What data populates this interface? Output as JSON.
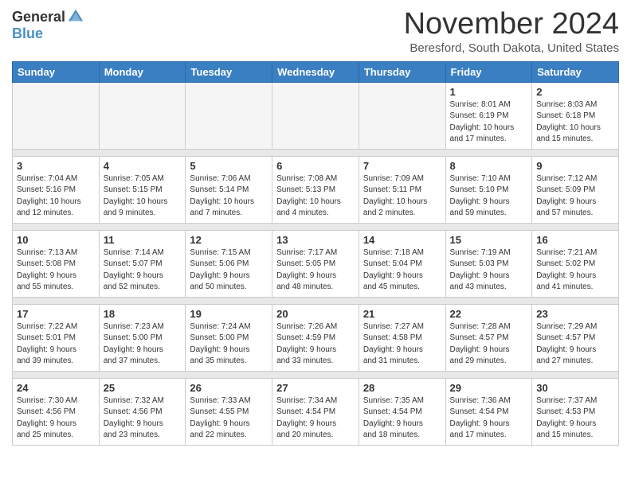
{
  "header": {
    "logo_general": "General",
    "logo_blue": "Blue",
    "month_title": "November 2024",
    "location": "Beresford, South Dakota, United States"
  },
  "days_of_week": [
    "Sunday",
    "Monday",
    "Tuesday",
    "Wednesday",
    "Thursday",
    "Friday",
    "Saturday"
  ],
  "weeks": [
    [
      {
        "day": "",
        "empty": true
      },
      {
        "day": "",
        "empty": true
      },
      {
        "day": "",
        "empty": true
      },
      {
        "day": "",
        "empty": true
      },
      {
        "day": "",
        "empty": true
      },
      {
        "day": "1",
        "info": "Sunrise: 8:01 AM\nSunset: 6:19 PM\nDaylight: 10 hours\nand 17 minutes."
      },
      {
        "day": "2",
        "info": "Sunrise: 8:03 AM\nSunset: 6:18 PM\nDaylight: 10 hours\nand 15 minutes."
      }
    ],
    [
      {
        "day": "3",
        "info": "Sunrise: 7:04 AM\nSunset: 5:16 PM\nDaylight: 10 hours\nand 12 minutes."
      },
      {
        "day": "4",
        "info": "Sunrise: 7:05 AM\nSunset: 5:15 PM\nDaylight: 10 hours\nand 9 minutes."
      },
      {
        "day": "5",
        "info": "Sunrise: 7:06 AM\nSunset: 5:14 PM\nDaylight: 10 hours\nand 7 minutes."
      },
      {
        "day": "6",
        "info": "Sunrise: 7:08 AM\nSunset: 5:13 PM\nDaylight: 10 hours\nand 4 minutes."
      },
      {
        "day": "7",
        "info": "Sunrise: 7:09 AM\nSunset: 5:11 PM\nDaylight: 10 hours\nand 2 minutes."
      },
      {
        "day": "8",
        "info": "Sunrise: 7:10 AM\nSunset: 5:10 PM\nDaylight: 9 hours\nand 59 minutes."
      },
      {
        "day": "9",
        "info": "Sunrise: 7:12 AM\nSunset: 5:09 PM\nDaylight: 9 hours\nand 57 minutes."
      }
    ],
    [
      {
        "day": "10",
        "info": "Sunrise: 7:13 AM\nSunset: 5:08 PM\nDaylight: 9 hours\nand 55 minutes."
      },
      {
        "day": "11",
        "info": "Sunrise: 7:14 AM\nSunset: 5:07 PM\nDaylight: 9 hours\nand 52 minutes."
      },
      {
        "day": "12",
        "info": "Sunrise: 7:15 AM\nSunset: 5:06 PM\nDaylight: 9 hours\nand 50 minutes."
      },
      {
        "day": "13",
        "info": "Sunrise: 7:17 AM\nSunset: 5:05 PM\nDaylight: 9 hours\nand 48 minutes."
      },
      {
        "day": "14",
        "info": "Sunrise: 7:18 AM\nSunset: 5:04 PM\nDaylight: 9 hours\nand 45 minutes."
      },
      {
        "day": "15",
        "info": "Sunrise: 7:19 AM\nSunset: 5:03 PM\nDaylight: 9 hours\nand 43 minutes."
      },
      {
        "day": "16",
        "info": "Sunrise: 7:21 AM\nSunset: 5:02 PM\nDaylight: 9 hours\nand 41 minutes."
      }
    ],
    [
      {
        "day": "17",
        "info": "Sunrise: 7:22 AM\nSunset: 5:01 PM\nDaylight: 9 hours\nand 39 minutes."
      },
      {
        "day": "18",
        "info": "Sunrise: 7:23 AM\nSunset: 5:00 PM\nDaylight: 9 hours\nand 37 minutes."
      },
      {
        "day": "19",
        "info": "Sunrise: 7:24 AM\nSunset: 5:00 PM\nDaylight: 9 hours\nand 35 minutes."
      },
      {
        "day": "20",
        "info": "Sunrise: 7:26 AM\nSunset: 4:59 PM\nDaylight: 9 hours\nand 33 minutes."
      },
      {
        "day": "21",
        "info": "Sunrise: 7:27 AM\nSunset: 4:58 PM\nDaylight: 9 hours\nand 31 minutes."
      },
      {
        "day": "22",
        "info": "Sunrise: 7:28 AM\nSunset: 4:57 PM\nDaylight: 9 hours\nand 29 minutes."
      },
      {
        "day": "23",
        "info": "Sunrise: 7:29 AM\nSunset: 4:57 PM\nDaylight: 9 hours\nand 27 minutes."
      }
    ],
    [
      {
        "day": "24",
        "info": "Sunrise: 7:30 AM\nSunset: 4:56 PM\nDaylight: 9 hours\nand 25 minutes."
      },
      {
        "day": "25",
        "info": "Sunrise: 7:32 AM\nSunset: 4:56 PM\nDaylight: 9 hours\nand 23 minutes."
      },
      {
        "day": "26",
        "info": "Sunrise: 7:33 AM\nSunset: 4:55 PM\nDaylight: 9 hours\nand 22 minutes."
      },
      {
        "day": "27",
        "info": "Sunrise: 7:34 AM\nSunset: 4:54 PM\nDaylight: 9 hours\nand 20 minutes."
      },
      {
        "day": "28",
        "info": "Sunrise: 7:35 AM\nSunset: 4:54 PM\nDaylight: 9 hours\nand 18 minutes."
      },
      {
        "day": "29",
        "info": "Sunrise: 7:36 AM\nSunset: 4:54 PM\nDaylight: 9 hours\nand 17 minutes."
      },
      {
        "day": "30",
        "info": "Sunrise: 7:37 AM\nSunset: 4:53 PM\nDaylight: 9 hours\nand 15 minutes."
      }
    ]
  ]
}
